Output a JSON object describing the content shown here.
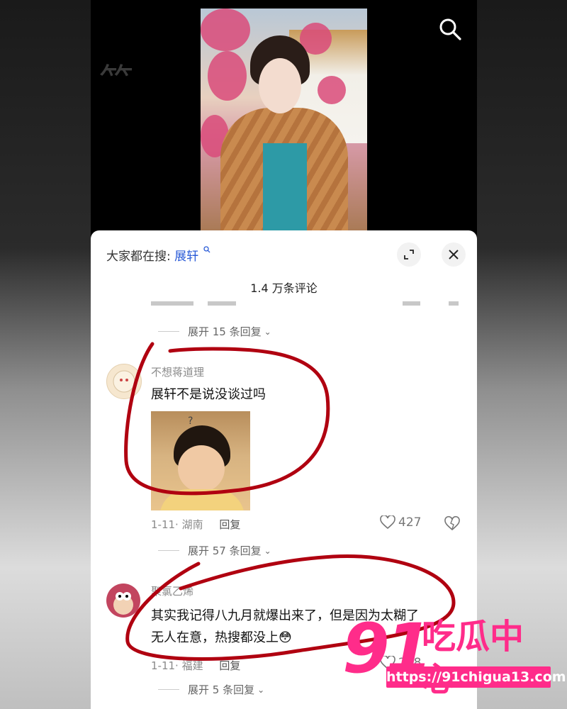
{
  "header": {
    "search_prefix": "大家都在搜:",
    "search_term": "展轩",
    "comment_count": "1.4 万条评论"
  },
  "thread1": {
    "expand_replies": "展开 15 条回复"
  },
  "comment1": {
    "username": "不想蒋道理",
    "text": "展轩不是说没谈过吗",
    "image_caption": "?",
    "date": "1-11",
    "location": "湖南",
    "reply_label": "回复",
    "likes": "427",
    "expand_replies": "展开 57 条回复"
  },
  "comment2": {
    "username": "聚氯乙烯",
    "text_line1": "其实我记得八九月就爆出来了，但是因为太糊了",
    "text_line2": "无人在意，热搜都没上",
    "emoji": "😳",
    "date": "1-11",
    "location": "福建",
    "reply_label": "回复",
    "likes": "248",
    "expand_replies": "展开 5 条回复"
  },
  "watermark": {
    "number": "91",
    "text": "吃瓜中心",
    "url": "https://91chigua13.com"
  },
  "colors": {
    "link_blue": "#2a5bd7",
    "annotation_red": "#b00010",
    "watermark_pink": "#ff2c8a"
  }
}
